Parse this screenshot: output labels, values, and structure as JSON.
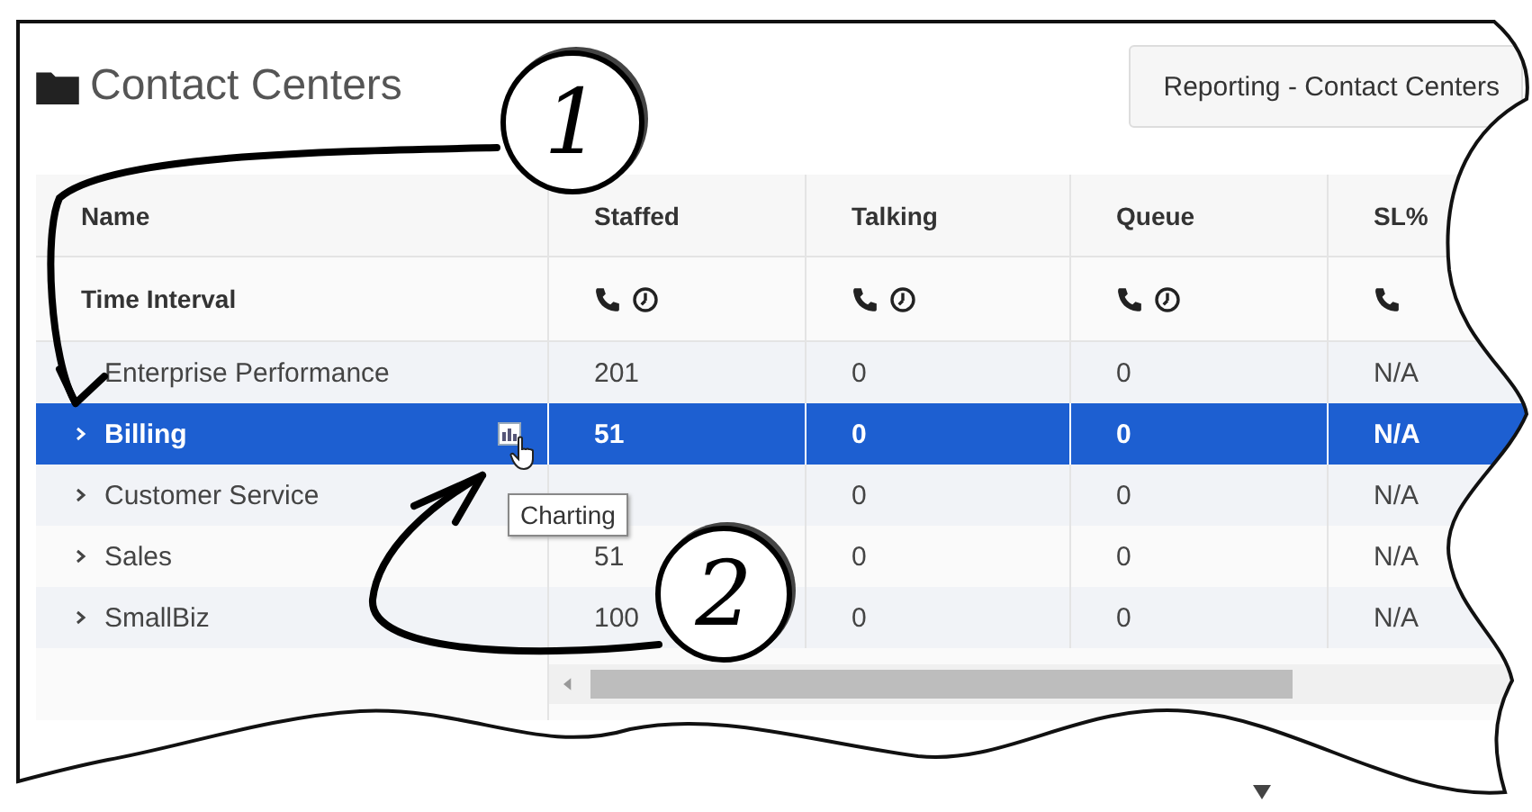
{
  "header": {
    "title": "Contact Centers",
    "button": "Reporting - Contact Centers"
  },
  "table": {
    "columns": [
      "Name",
      "Staffed",
      "Talking",
      "Queue",
      "SL%"
    ],
    "interval_row": {
      "label": "Time Interval",
      "icons": [
        {
          "kind": "phone-clock"
        },
        {
          "kind": "phone-clock"
        },
        {
          "kind": "phone-clock"
        },
        {
          "kind": "phone"
        }
      ]
    },
    "rows": [
      {
        "name": "Enterprise Performance",
        "expandable": false,
        "selected": false,
        "staffed": "201",
        "values": [
          "0",
          "0",
          "N/A"
        ]
      },
      {
        "name": "Billing",
        "expandable": true,
        "selected": true,
        "staffed": "51",
        "values": [
          "0",
          "0",
          "N/A"
        ],
        "tooltip": "Charting"
      },
      {
        "name": "Customer Service",
        "expandable": true,
        "selected": false,
        "values": [
          "0",
          "0",
          "N/A"
        ]
      },
      {
        "name": "Sales",
        "expandable": true,
        "selected": false,
        "staffed": "51",
        "values": [
          "0",
          "0",
          "N/A"
        ]
      },
      {
        "name": "SmallBiz",
        "expandable": true,
        "selected": false,
        "staffed": "100",
        "values": [
          "0",
          "0",
          "N/A"
        ]
      }
    ]
  },
  "annotations": [
    {
      "label": "1"
    },
    {
      "label": "2"
    }
  ]
}
